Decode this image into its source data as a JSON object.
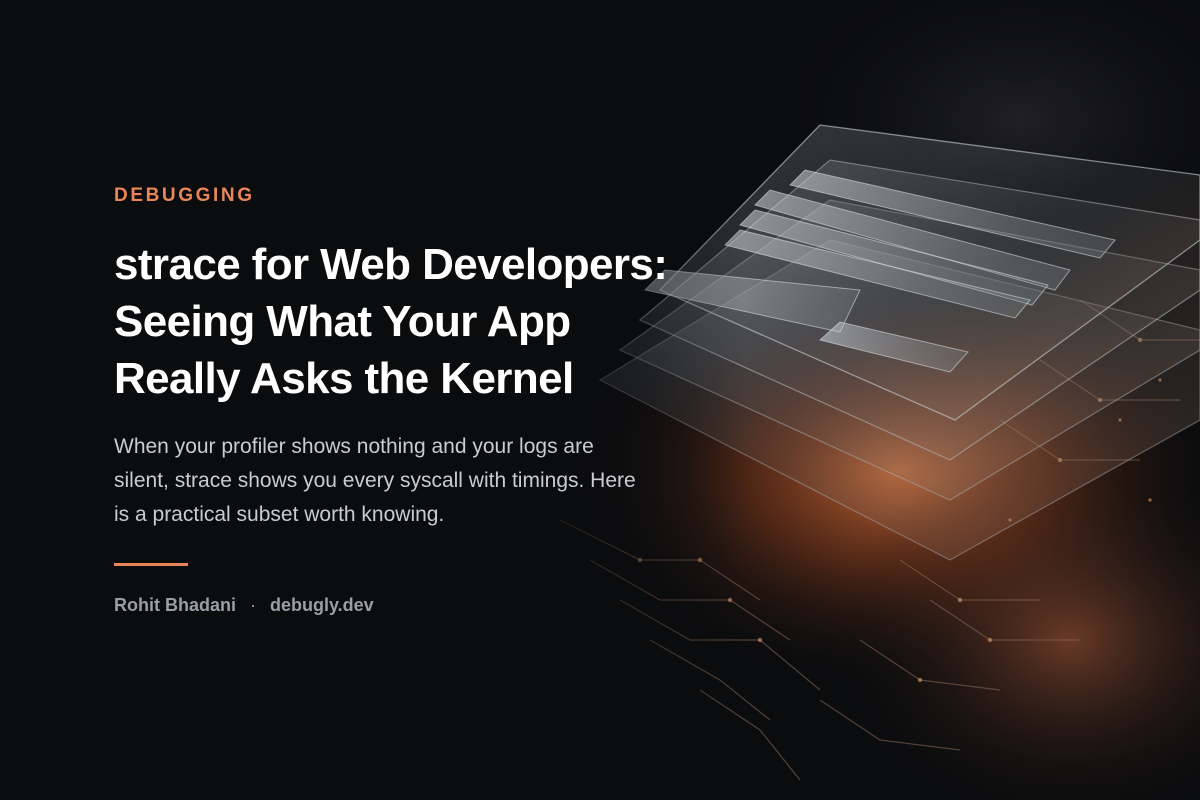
{
  "post": {
    "category": "DEBUGGING",
    "title_lines": [
      "strace for Web Developers:",
      "Seeing What Your App",
      "Really Asks the Kernel"
    ],
    "dek_lines": [
      "When your profiler shows nothing and your logs are",
      "silent, strace shows you every syscall with timings. Here",
      "is a practical subset worth knowing."
    ],
    "author": "Rohit Bhadani",
    "separator": "·",
    "site": "debugly.dev"
  },
  "colors": {
    "background": "#0b0c0e",
    "accent": "#e8865a",
    "title": "#ffffff",
    "dek": "#c9ccd1",
    "byline": "#9a9ea5"
  }
}
